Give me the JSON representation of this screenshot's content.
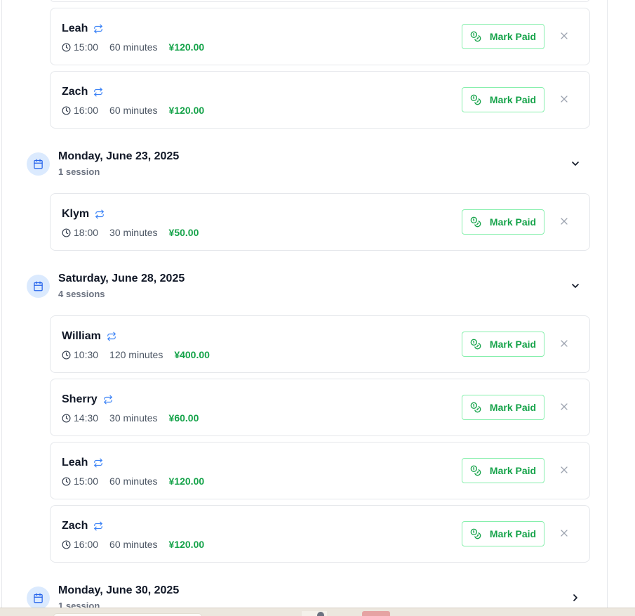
{
  "colors": {
    "price_green": "#16a34a",
    "repeat_blue": "#3b82f6",
    "calendar_badge_bg": "#dbeafe"
  },
  "icons": {
    "repeat": "repeat-icon",
    "clock": "clock-icon",
    "pay": "coins-icon",
    "close": "close-icon",
    "calendar": "calendar-icon",
    "expanded": "chevron-down-icon",
    "collapsed": "chevron-right-icon"
  },
  "days": [
    {
      "date": "",
      "count": "",
      "expanded": true,
      "sessions": [
        {
          "name": "Leah",
          "time": "15:00",
          "duration": "60 minutes",
          "price": "¥120.00",
          "action": "Mark Paid"
        },
        {
          "name": "Zach",
          "time": "16:00",
          "duration": "60 minutes",
          "price": "¥120.00",
          "action": "Mark Paid"
        }
      ]
    },
    {
      "date": "Monday, June 23, 2025",
      "count": "1 session",
      "expanded": true,
      "sessions": [
        {
          "name": "Klym",
          "time": "18:00",
          "duration": "30 minutes",
          "price": "¥50.00",
          "action": "Mark Paid"
        }
      ]
    },
    {
      "date": "Saturday, June 28, 2025",
      "count": "4 sessions",
      "expanded": true,
      "sessions": [
        {
          "name": "William",
          "time": "10:30",
          "duration": "120 minutes",
          "price": "¥400.00",
          "action": "Mark Paid"
        },
        {
          "name": "Sherry",
          "time": "14:30",
          "duration": "30 minutes",
          "price": "¥60.00",
          "action": "Mark Paid"
        },
        {
          "name": "Leah",
          "time": "15:00",
          "duration": "60 minutes",
          "price": "¥120.00",
          "action": "Mark Paid"
        },
        {
          "name": "Zach",
          "time": "16:00",
          "duration": "60 minutes",
          "price": "¥120.00",
          "action": "Mark Paid"
        }
      ]
    },
    {
      "date": "Monday, June 30, 2025",
      "count": "1 session",
      "expanded": false,
      "sessions": []
    }
  ]
}
